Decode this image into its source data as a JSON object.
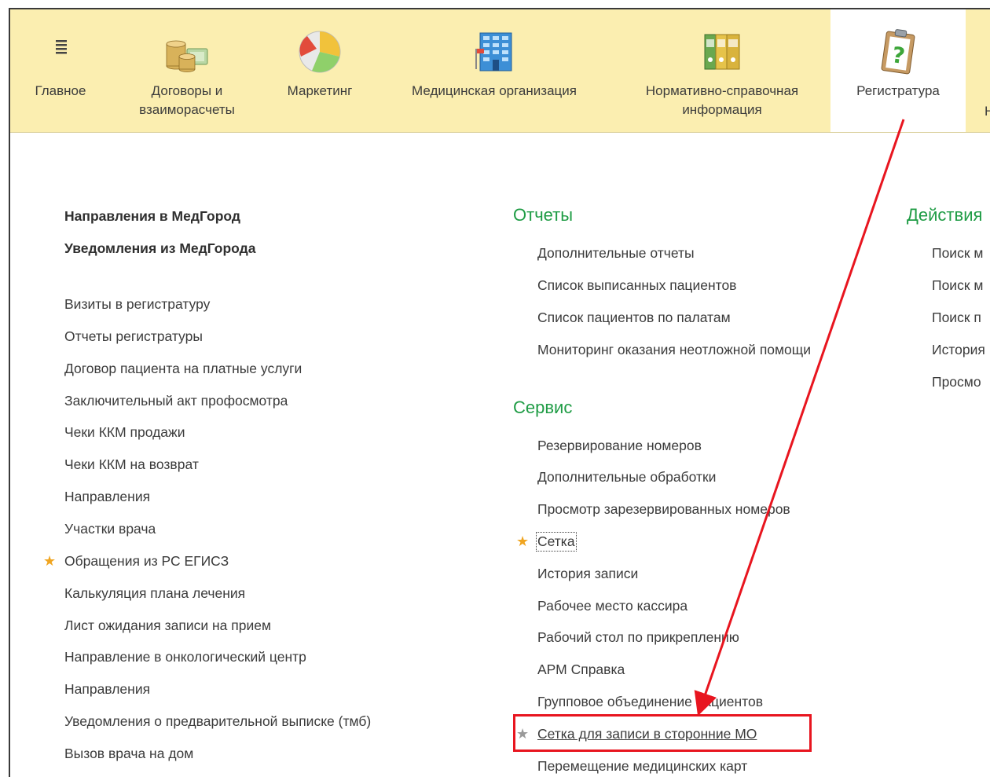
{
  "top_sections": [
    {
      "label": "Главное",
      "icon": "menu-icon"
    },
    {
      "label": "Договоры и\nвзаиморасчеты",
      "icon": "coins-money-icon"
    },
    {
      "label": "Маркетинг",
      "icon": "pie-chart-icon"
    },
    {
      "label": "Медицинская организация",
      "icon": "building-icon"
    },
    {
      "label": "Нормативно-справочная\nинформация",
      "icon": "binders-icon"
    },
    {
      "label": "Регистратура",
      "icon": "clipboard-question-icon",
      "active": true
    },
    {
      "label": "Н",
      "icon": "",
      "partial": true
    }
  ],
  "left_column": {
    "bold_items": [
      "Направления в МедГород",
      "Уведомления из МедГорода"
    ],
    "items": [
      "Визиты в регистратуру",
      "Отчеты регистратуры",
      "Договор пациента на платные услуги",
      "Заключительный акт профосмотра",
      "Чеки ККМ продажи",
      "Чеки ККМ на возврат",
      "Направления",
      "Участки врача",
      "Обращения из РС ЕГИСЗ",
      "Калькуляция плана лечения",
      "Лист ожидания записи на прием",
      "Направление в онкологический центр",
      "Направления",
      "Уведомления о предварительной выписке (тмб)",
      "Вызов врача на дом"
    ]
  },
  "middle_column": {
    "reports_heading": "Отчеты",
    "reports": [
      "Дополнительные отчеты",
      "Список выписанных пациентов",
      "Список пациентов по палатам",
      "Мониторинг оказания неотложной помощи"
    ],
    "service_heading": "Сервис",
    "service": [
      "Резервирование номеров",
      "Дополнительные обработки",
      "Просмотр зарезервированных номеров",
      "Сетка",
      "История записи",
      "Рабочее место кассира",
      "Рабочий стол по прикреплению",
      "АРМ Справка",
      "Групповое объединение пациентов",
      "Сетка для записи в сторонние МО",
      "Перемещение медицинских карт"
    ]
  },
  "right_column": {
    "heading": "Действия",
    "items": [
      "Поиск м",
      "Поиск м",
      "Поиск п",
      "История",
      "Просмо"
    ]
  },
  "colors": {
    "topbar": "#fbeeb0",
    "heading_green": "#1f9c45",
    "star_gold": "#f0a521",
    "annotation_red": "#e8151f"
  }
}
